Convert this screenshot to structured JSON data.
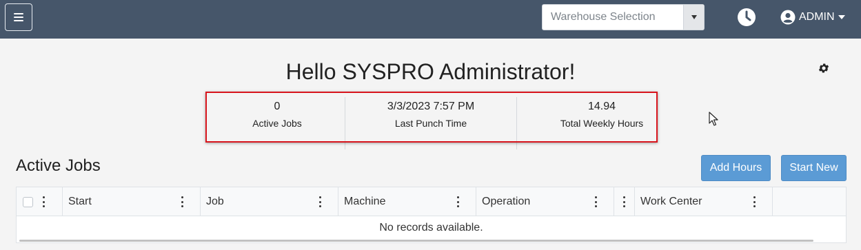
{
  "header": {
    "warehouse_placeholder": "Warehouse Selection",
    "user_label": "ADMIN"
  },
  "greeting": "Hello SYSPRO Administrator!",
  "stats": [
    {
      "value": "0",
      "label": "Active Jobs"
    },
    {
      "value": "3/3/2023 7:57 PM",
      "label": "Last Punch Time"
    },
    {
      "value": "14.94",
      "label": "Total Weekly Hours"
    }
  ],
  "active_jobs": {
    "title": "Active Jobs",
    "add_hours_label": "Add Hours",
    "start_new_label": "Start New",
    "columns": [
      "Start",
      "Job",
      "Machine",
      "Operation",
      "Work Center"
    ],
    "empty_message": "No records available."
  },
  "colors": {
    "navbar": "#46566a",
    "button": "#5b9bd5",
    "highlight": "#d8141c"
  }
}
